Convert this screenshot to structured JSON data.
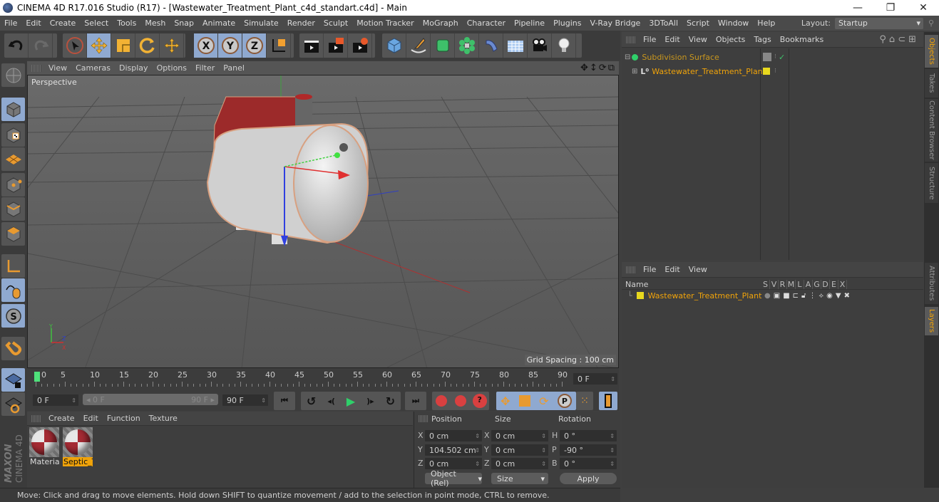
{
  "window": {
    "title": "CINEMA 4D R17.016 Studio (R17) - [Wastewater_Treatment_Plant_c4d_standart.c4d] - Main",
    "minimize": "—",
    "restore": "❐",
    "close": "✕"
  },
  "menubar": {
    "items": [
      "File",
      "Edit",
      "Create",
      "Select",
      "Tools",
      "Mesh",
      "Snap",
      "Animate",
      "Simulate",
      "Render",
      "Sculpt",
      "Motion Tracker",
      "MoGraph",
      "Character",
      "Pipeline",
      "Plugins",
      "V-Ray Bridge",
      "3DToAll",
      "Script",
      "Window",
      "Help"
    ],
    "layout_label": "Layout:",
    "layout_value": "Startup"
  },
  "toolbar": {
    "icons": [
      "undo-icon",
      "redo-icon",
      "live-selection-icon",
      "move-icon",
      "scale-icon",
      "rotate-icon",
      "last-tool-icon",
      "x-axis-lock-icon",
      "y-axis-lock-icon",
      "z-axis-lock-icon",
      "coordinate-system-icon",
      "render-view-icon",
      "render-picture-viewer-icon",
      "render-settings-icon",
      "cube-primitive-icon",
      "pen-spline-icon",
      "subdivision-surface-icon",
      "array-generator-icon",
      "deformer-icon",
      "floor-icon",
      "camera-icon",
      "light-icon"
    ]
  },
  "viewport": {
    "menu": [
      "View",
      "Cameras",
      "Display",
      "Options",
      "Filter",
      "Panel"
    ],
    "camera_label": "Perspective",
    "grid_spacing": "Grid Spacing : 100 cm"
  },
  "timeline": {
    "ticks": [
      "0",
      "5",
      "10",
      "15",
      "20",
      "25",
      "30",
      "35",
      "40",
      "45",
      "50",
      "55",
      "60",
      "65",
      "70",
      "75",
      "80",
      "85",
      "90"
    ],
    "current_frame": "0 F",
    "start_field": "0 F",
    "range_start": "0 F",
    "range_end": "90 F",
    "end_field": "90 F"
  },
  "materials": {
    "menu": [
      "Create",
      "Edit",
      "Function",
      "Texture"
    ],
    "items": [
      {
        "label": "Material",
        "selected": false
      },
      {
        "label": "Septic_T",
        "selected": true
      }
    ]
  },
  "coordinates": {
    "headers": {
      "position": "Position",
      "size": "Size",
      "rotation": "Rotation"
    },
    "position": [
      {
        "axis": "X",
        "value": "0 cm"
      },
      {
        "axis": "Y",
        "value": "104.502 cm"
      },
      {
        "axis": "Z",
        "value": "0 cm"
      }
    ],
    "size": [
      {
        "axis": "X",
        "value": "0 cm"
      },
      {
        "axis": "Y",
        "value": "0 cm"
      },
      {
        "axis": "Z",
        "value": "0 cm"
      }
    ],
    "rotation": [
      {
        "axis": "H",
        "value": "0 °"
      },
      {
        "axis": "P",
        "value": "-90 °"
      },
      {
        "axis": "B",
        "value": "0 °"
      }
    ],
    "mode": "Object (Rel)",
    "size_mode": "Size",
    "apply": "Apply"
  },
  "status": "Move: Click and drag to move elements. Hold down SHIFT to quantize movement / add to the selection in point mode, CTRL to remove.",
  "object_manager": {
    "menu": [
      "File",
      "Edit",
      "View",
      "Objects",
      "Tags",
      "Bookmarks"
    ],
    "objects": [
      {
        "name": "Subdivision Surface",
        "color": "#c8961e"
      },
      {
        "name": "Wastewater_Treatment_Plant",
        "color": "#f0a30a"
      }
    ]
  },
  "layer_manager": {
    "menu": [
      "File",
      "Edit",
      "View"
    ],
    "name_header": "Name",
    "columns": [
      "S",
      "V",
      "R",
      "M",
      "L",
      "A",
      "G",
      "D",
      "E",
      "X"
    ],
    "layers": [
      {
        "name": "Wastewater_Treatment_Plant",
        "color": "#e8d81e"
      }
    ]
  },
  "right_tabs": {
    "top": [
      {
        "label": "Objects",
        "active": true
      },
      {
        "label": "Takes",
        "active": false
      },
      {
        "label": "Content Browser",
        "active": false
      },
      {
        "label": "Structure",
        "active": false
      }
    ],
    "bottom": [
      {
        "label": "Attributes",
        "active": false
      },
      {
        "label": "Layers",
        "active": true
      }
    ]
  },
  "brand": {
    "line1": "MAXON",
    "line2": "CINEMA 4D"
  },
  "colors": {
    "accent": "#f0a30a",
    "selected_button": "#8fa9d0",
    "panel": "#3e3e3e"
  }
}
